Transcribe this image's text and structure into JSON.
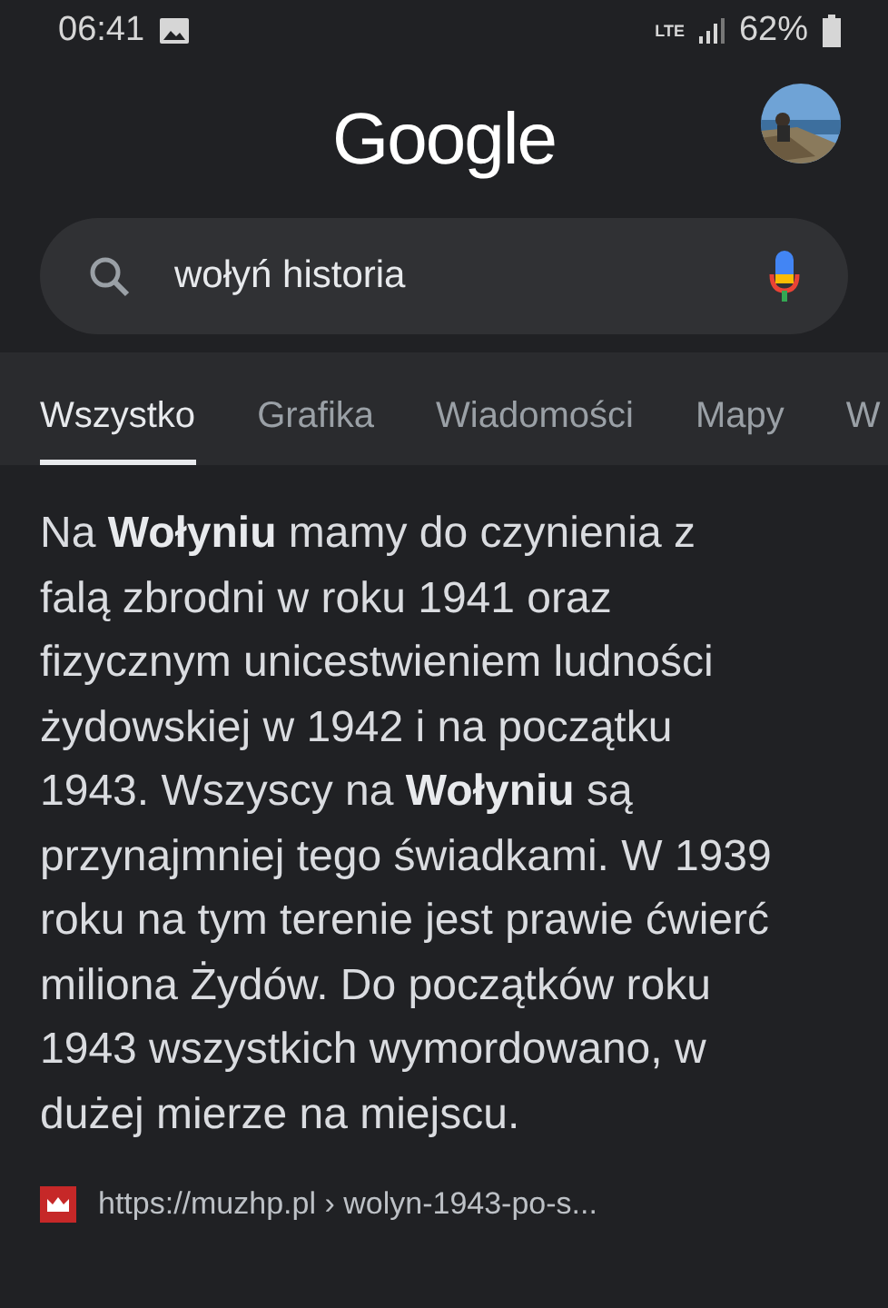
{
  "status_bar": {
    "time": "06:41",
    "network": "LTE",
    "battery": "62%"
  },
  "logo": "Google",
  "search": {
    "value": "wołyń historia"
  },
  "tabs": [
    {
      "label": "Wszystko",
      "selected": true
    },
    {
      "label": "Grafika",
      "selected": false
    },
    {
      "label": "Wiadomości",
      "selected": false
    },
    {
      "label": "Mapy",
      "selected": false
    },
    {
      "label": "W",
      "selected": false
    }
  ],
  "result": {
    "snippet": "Na **Wołyniu** mamy do czynienia z falą zbrodni w roku 1941 oraz fizycznym unicestwieniem ludności żydowskiej w 1942 i na początku 1943. Wszyscy na **Wołyniu** są przynajmniej tego świadkami. W 1939 roku na tym terenie jest prawie ćwierć miliona Żydów. Do początków roku 1943 wszystkich wymordowano, w dużej mierze na miejscu.",
    "url": "https://muzhp.pl › wolyn-1943-po-s..."
  }
}
